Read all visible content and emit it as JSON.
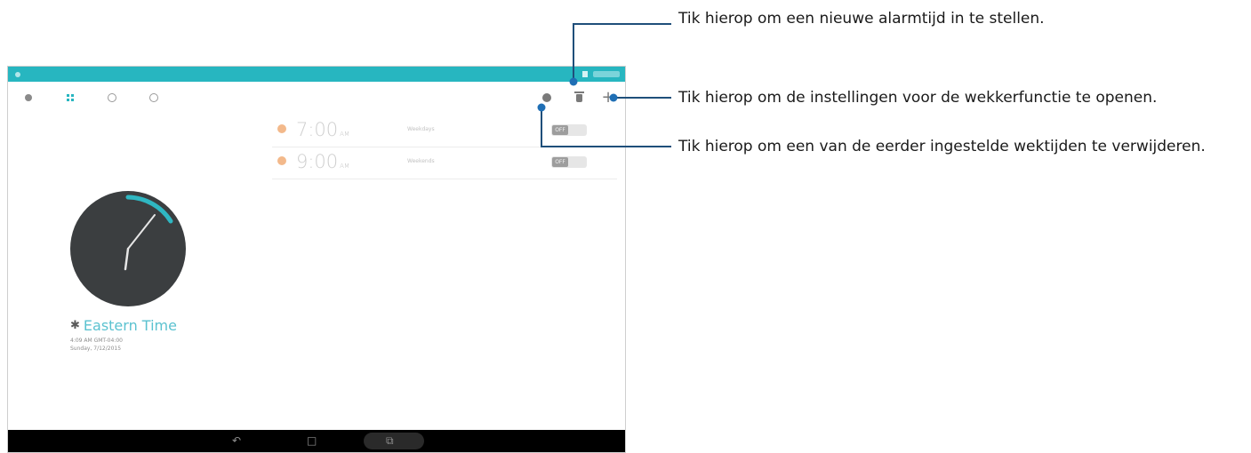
{
  "callouts": {
    "add_alarm": "Tik hierop om een nieuwe alarmtijd in te stellen.",
    "settings": "Tik hierop om de instellingen voor de wekkerfunctie te openen.",
    "delete": "Tik hierop om een van de eerder ingestelde wektijden te verwijderen."
  },
  "toolbar": {
    "tabs": [
      {
        "icon": "world-clock-icon"
      },
      {
        "icon": "alarm-icon",
        "active": true
      },
      {
        "icon": "stopwatch-icon"
      },
      {
        "icon": "timer-icon"
      }
    ],
    "actions": [
      {
        "icon": "settings-icon"
      },
      {
        "icon": "delete-icon"
      },
      {
        "icon": "add-icon",
        "glyph": "+"
      }
    ]
  },
  "alarms": [
    {
      "time": "7:00",
      "ampm": "AM",
      "label": "Weekdays",
      "toggle": "OFF"
    },
    {
      "time": "9:00",
      "ampm": "AM",
      "label": "Weekends",
      "toggle": "OFF"
    }
  ],
  "world_clock": {
    "zone": "Eastern Time",
    "time_line": "4:09 AM  GMT-04:00",
    "date_line": "Sunday, 7/12/2015"
  },
  "navbar": {
    "back_glyph": "↶",
    "home_glyph": "□",
    "recents_glyph": "⧉"
  },
  "colors": {
    "accent": "#27b6c0",
    "clock_face": "#3b3e40",
    "callout_line": "#1f4f7a"
  }
}
